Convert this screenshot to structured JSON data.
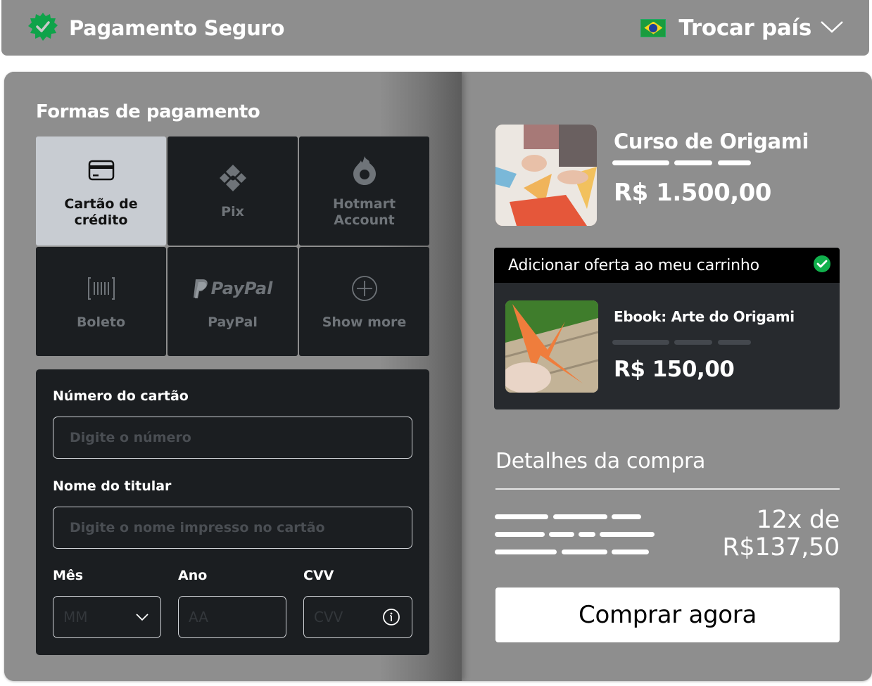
{
  "header": {
    "title": "Pagamento Seguro",
    "secure_icon": "verified-badge-icon",
    "country_flag": "brazil-flag",
    "country_label": "Trocar país",
    "accent_color": "#0fa34a"
  },
  "payment": {
    "section_title": "Formas de pagamento",
    "methods": [
      {
        "label": "Cartão de crédito",
        "icon": "credit-card-icon",
        "selected": true
      },
      {
        "label": "Pix",
        "icon": "pix-icon",
        "selected": false
      },
      {
        "label": "Hotmart Account",
        "icon": "hotmart-flame-icon",
        "selected": false
      },
      {
        "label": "Boleto",
        "icon": "barcode-icon",
        "selected": false
      },
      {
        "label": "PayPal",
        "icon": "paypal-logo-icon",
        "logo_text": "PayPal",
        "selected": false
      },
      {
        "label": "Show more",
        "icon": "plus-circle-icon",
        "selected": false
      }
    ],
    "form": {
      "card_number_label": "Número do cartão",
      "card_number_placeholder": "Digite o número",
      "holder_label": "Nome do titular",
      "holder_placeholder": "Digite o nome impresso no cartão",
      "month_label": "Mês",
      "month_placeholder": "MM",
      "year_label": "Ano",
      "year_placeholder": "AA",
      "cvv_label": "CVV",
      "cvv_placeholder": "CVV"
    }
  },
  "product": {
    "title": "Curso de Origami",
    "price": "R$ 1.500,00"
  },
  "offer": {
    "header_label": "Adicionar oferta ao meu carrinho",
    "checked": true,
    "title": "Ebook: Arte do Origami",
    "price": "R$ 150,00"
  },
  "summary": {
    "title": "Detalhes da compra",
    "installments_line1": "12x de",
    "installments_line2": "R$137,50",
    "buy_label": "Comprar agora"
  }
}
